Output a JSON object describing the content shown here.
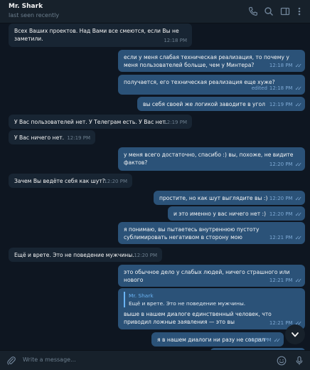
{
  "header": {
    "title": "Mr. Shark",
    "status": "last seen recently",
    "icons": [
      "phone-icon",
      "search-icon",
      "sidebar-toggle-icon",
      "more-icon"
    ]
  },
  "messages": [
    {
      "dir": "in",
      "text": "Всех Ваших проектов. Над Вами все смеются, если Вы не заметили.",
      "time": "12:18 PM"
    },
    {
      "dir": "out",
      "text": "если у меня слабая техническая реализация, то почему у меня пользователей больше, чем у Минтера?",
      "time": "12:18 PM",
      "read": true
    },
    {
      "dir": "out",
      "text": "получается, его техническая реализация еще хуже?",
      "time": "12:18 PM",
      "edited": "edited",
      "read": true
    },
    {
      "dir": "out",
      "text": "вы себя своей же логикой заводите в угол",
      "time": "12:19 PM",
      "read": true
    },
    {
      "dir": "in",
      "text": "У Вас пользователей нет. У Телеграм есть. У Вас нет.",
      "time": "12:19 PM"
    },
    {
      "dir": "in",
      "text": "У Вас ничего нет.",
      "time": "12:19 PM"
    },
    {
      "dir": "out",
      "text": "у меня всего достаточно, спасибо :) вы, похоже, не видите фактов?",
      "time": "12:20 PM",
      "read": true
    },
    {
      "dir": "in",
      "text": "Зачем Вы ведёте себя как шут?",
      "time": "12:20 PM"
    },
    {
      "dir": "out",
      "text": "простите, но как шут выглядите вы :)",
      "time": "12:20 PM",
      "read": true
    },
    {
      "dir": "out",
      "text": "и это именно у вас ничего нет :)",
      "time": "12:20 PM",
      "read": true
    },
    {
      "dir": "out",
      "text": "я понимаю, вы пытаетесь внутреннюю пустоту сублимировать негативом в сторону мою",
      "time": "12:21 PM",
      "read": true
    },
    {
      "dir": "in",
      "text": "Ещё и врете. Это не поведение мужчины.",
      "time": "12:20 PM"
    },
    {
      "dir": "out",
      "text": "это обычное дело у слабых людей, ничего страшного или нового",
      "time": "12:21 PM",
      "read": true
    },
    {
      "dir": "out",
      "reply_name": "Mr. Shark",
      "reply_text": "Ещё и врете. Это не поведение мужчины.",
      "text": "выше в нашем диалоге единственный человек, что приводил ложные заявления — это вы",
      "time": "12:21 PM",
      "read": true
    },
    {
      "dir": "out",
      "text": "я в нашем диалоги ни разу не соврал",
      "time": "12:21 PM",
      "read": true
    }
  ],
  "composer": {
    "placeholder": "Write a message..."
  },
  "colors": {
    "background": "#0e1621",
    "header": "#17212b",
    "incoming": "#182533",
    "outgoing": "#2b5278",
    "accent": "#6ab3f3"
  }
}
